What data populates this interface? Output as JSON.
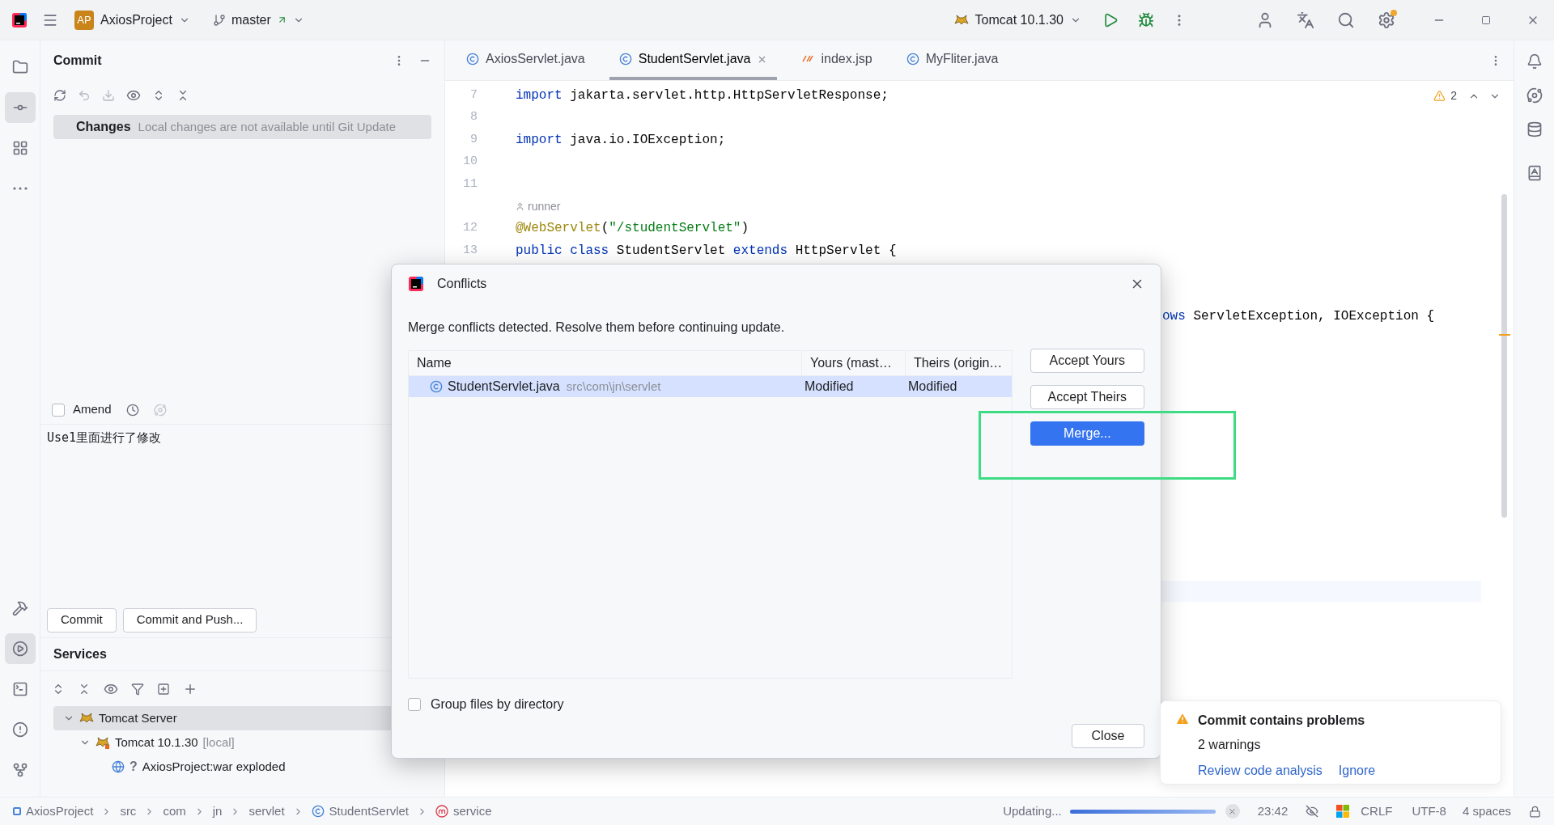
{
  "title_bar": {
    "project_badge": "AP",
    "project": "AxiosProject",
    "branch": "master",
    "run_config": "Tomcat 10.1.30"
  },
  "left_toolbar": {
    "top": [
      {
        "selected": false
      },
      {
        "selected": true
      },
      {
        "selected": false
      },
      {
        "selected": false
      }
    ],
    "bottom": [
      {
        "selected": false
      },
      {
        "selected": true
      },
      {
        "selected": false
      },
      {
        "selected": false
      },
      {
        "selected": false
      }
    ]
  },
  "commit_panel": {
    "title": "Commit",
    "changes_label": "Changes",
    "changes_note": "Local changes are not available until Git Update",
    "amend": {
      "label": "Amend",
      "checked": false
    },
    "message": "Use1里面进行了修改",
    "buttons": [
      "Commit",
      "Commit and Push..."
    ]
  },
  "services": {
    "title": "Services",
    "tree": [
      {
        "label": "Tomcat Server",
        "expanded": true,
        "selected": true,
        "children": [
          {
            "label": "Tomcat 10.1.30",
            "note": "[local]",
            "expanded": true,
            "selected": false,
            "children": [
              {
                "label": "AxiosProject:war exploded",
                "prefix": "?",
                "selected": false
              }
            ]
          }
        ]
      }
    ]
  },
  "editor": {
    "tabs": [
      {
        "label": "AxiosServlet.java",
        "kind": "class",
        "selected": false
      },
      {
        "label": "StudentServlet.java",
        "kind": "class",
        "selected": true
      },
      {
        "label": "index.jsp",
        "kind": "jsp",
        "selected": false
      },
      {
        "label": "MyFliter.java",
        "kind": "class",
        "selected": false
      }
    ],
    "warnings": "2",
    "lines": [
      {
        "kind": "code",
        "number": "7",
        "tokens": [
          {
            "kind": "keyword",
            "text": "import"
          },
          {
            "kind": "plain",
            "text": " jakarta.servlet.http.HttpServletResponse;"
          }
        ]
      },
      {
        "kind": "code",
        "number": "8"
      },
      {
        "kind": "code",
        "number": "9",
        "tokens": [
          {
            "kind": "keyword",
            "text": "import"
          },
          {
            "kind": "plain",
            "text": " java.io.IOException;"
          }
        ]
      },
      {
        "kind": "code",
        "number": "10"
      },
      {
        "kind": "code",
        "number": "11"
      },
      {
        "kind": "inlay",
        "text": "runner"
      },
      {
        "kind": "code",
        "number": "12",
        "tokens": [
          {
            "kind": "annotation",
            "text": "@WebServlet"
          },
          {
            "kind": "plain",
            "text": "("
          },
          {
            "kind": "string",
            "text": "\"/studentServlet\""
          },
          {
            "kind": "plain",
            "text": ")"
          }
        ]
      },
      {
        "kind": "code",
        "number": "13",
        "tokens": [
          {
            "kind": "keyword",
            "text": "public class"
          },
          {
            "kind": "plain",
            "text": " StudentServlet "
          },
          {
            "kind": "keyword",
            "text": "extends"
          },
          {
            "kind": "plain",
            "text": " HttpServlet {"
          }
        ]
      },
      {
        "kind": "fragment",
        "tokens": [
          {
            "kind": "keyword",
            "text": "ows"
          },
          {
            "kind": "plain",
            "text": " ServletException, IOException {"
          }
        ]
      }
    ]
  },
  "dialog": {
    "title": "Conflicts",
    "message": "Merge conflicts detected. Resolve them before continuing update.",
    "columns": [
      "Name",
      "Yours (mast…",
      "Theirs (origin…"
    ],
    "rows": [
      {
        "name": "StudentServlet.java",
        "path": "src\\com\\jn\\servlet",
        "yours": "Modified",
        "theirs": "Modified",
        "selected": true
      }
    ],
    "buttons": [
      {
        "label": "Accept Yours",
        "kind": "default"
      },
      {
        "label": "Accept Theirs",
        "kind": "default"
      },
      {
        "label": "Merge...",
        "kind": "primary"
      }
    ],
    "group_by_directory": {
      "label": "Group files by directory",
      "checked": false
    },
    "close": "Close"
  },
  "notification": {
    "title": "Commit contains problems",
    "detail": "2 warnings",
    "links": [
      "Review code analysis",
      "Ignore"
    ]
  },
  "status_bar": {
    "breadcrumbs": [
      {
        "label": "AxiosProject",
        "kind": "project"
      },
      {
        "label": "src",
        "kind": "folder"
      },
      {
        "label": "com",
        "kind": "folder"
      },
      {
        "label": "jn",
        "kind": "folder"
      },
      {
        "label": "servlet",
        "kind": "folder"
      },
      {
        "label": "StudentServlet",
        "kind": "class"
      },
      {
        "label": "service",
        "kind": "method"
      }
    ],
    "task": "Updating...",
    "progress": {
      "level": 1
    },
    "time": "23:42",
    "line_separator": "CRLF",
    "encoding": "UTF-8",
    "indent": "4 spaces"
  }
}
